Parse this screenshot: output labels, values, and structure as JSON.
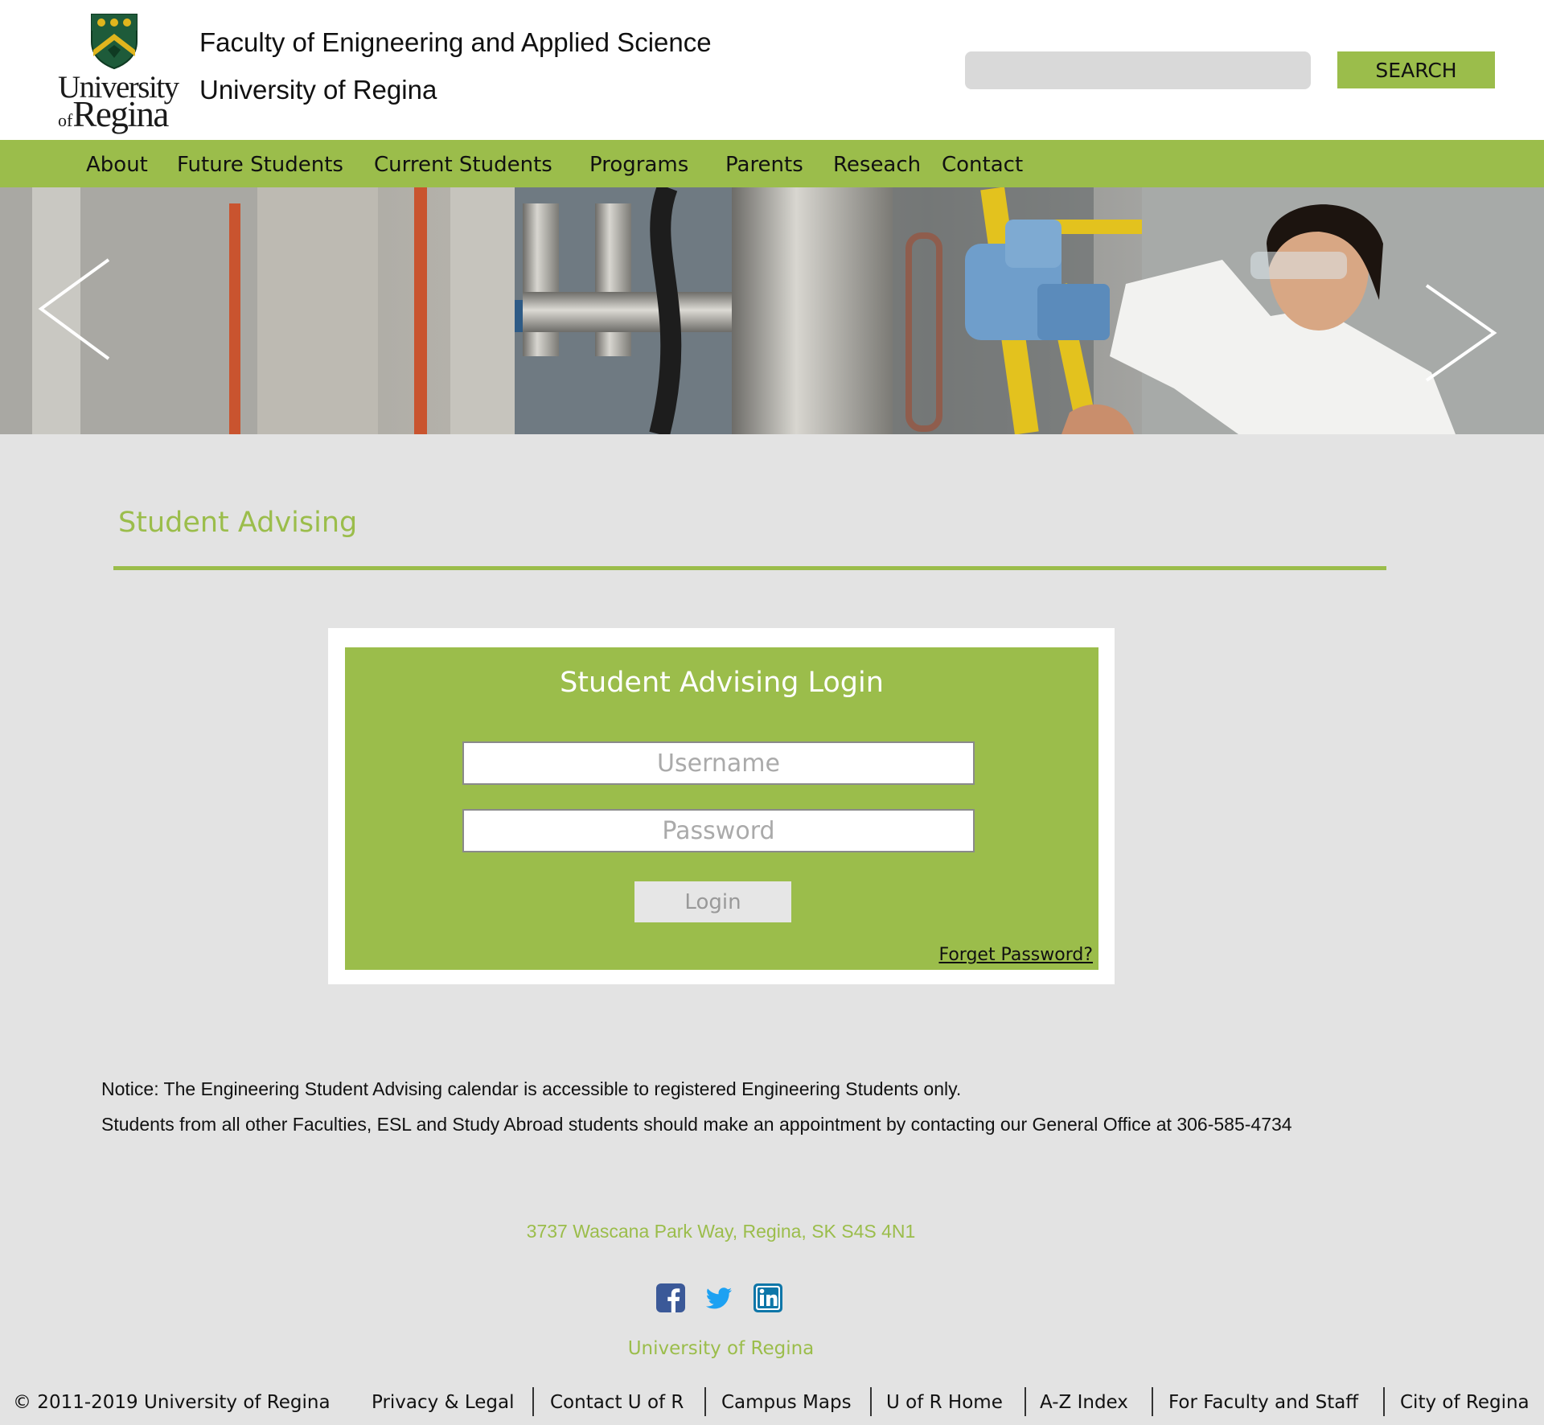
{
  "header": {
    "logo": {
      "word1": "University",
      "word2_prefix": "of",
      "word2": "Regina"
    },
    "faculty_title": "Faculty of Enigneering and Applied Science",
    "university_title": "University of Regina",
    "search": {
      "placeholder": "",
      "button_label": "SEARCH"
    }
  },
  "nav": {
    "items": [
      {
        "label": "About"
      },
      {
        "label": "Future Students"
      },
      {
        "label": "Current Students"
      },
      {
        "label": "Programs"
      },
      {
        "label": "Parents"
      },
      {
        "label": "Reseach"
      },
      {
        "label": "Contact"
      }
    ]
  },
  "hero": {
    "prev_icon": "chevron-left-icon",
    "next_icon": "chevron-right-icon"
  },
  "section": {
    "title": "Student Advising"
  },
  "login": {
    "title": "Student Advising Login",
    "username_placeholder": "Username",
    "password_placeholder": "Password",
    "button_label": "Login",
    "forgot_label": "Forget Password?"
  },
  "notice": {
    "line1": "Notice: The Engineering Student Advising calendar is accessible to registered Engineering Students only.",
    "line2": "Students from all other Faculties, ESL and Study Abroad students should make an appointment by contacting our General Office at 306-585-4734"
  },
  "footer": {
    "address": "3737 Wascana Park Way, Regina, SK S4S 4N1",
    "social": [
      "facebook-icon",
      "twitter-icon",
      "linkedin-icon"
    ],
    "org": "University of Regina",
    "copyright": "© 2011-2019 University of Regina",
    "links": [
      {
        "label": "Privacy & Legal"
      },
      {
        "label": "Contact U of R"
      },
      {
        "label": "Campus Maps"
      },
      {
        "label": "U of R Home"
      },
      {
        "label": "A-Z Index"
      },
      {
        "label": "For Faculty and Staff"
      },
      {
        "label": "City of Regina"
      }
    ]
  },
  "colors": {
    "accent_green": "#9bbd4b",
    "background_gray": "#e3e3e3",
    "crest_green": "#1e5b3a",
    "crest_gold": "#e0b51d"
  }
}
